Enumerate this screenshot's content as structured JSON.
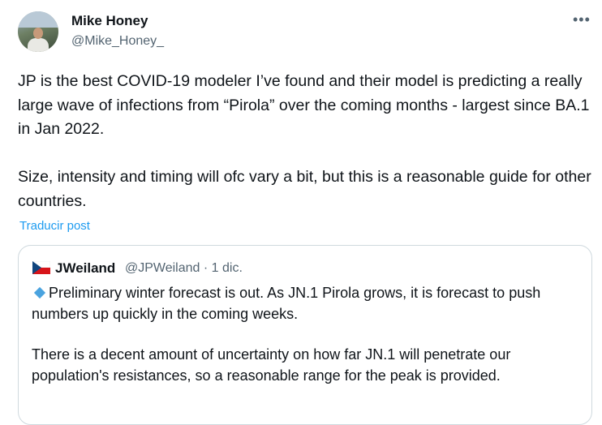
{
  "author": {
    "name": "Mike Honey",
    "handle": "@Mike_Honey_"
  },
  "menu": {
    "more_label": "•••"
  },
  "tweet": {
    "text": "JP is the best COVID-19 modeler I’ve found and their model is predicting a really large wave of infections from “Pirola” over the coming months - largest since BA.1 in Jan 2022.\n\nSize, intensity and timing will ofc vary a bit, but this is a reasonable guide for other countries.",
    "translate_label": "Traducir post"
  },
  "quote": {
    "name": "JWeiland",
    "meta": "@JPWeiland · 1 dic.",
    "paragraph1": "Preliminary winter forecast is out.  As JN.1 Pirola grows, it is forecast to push numbers up quickly in the coming weeks.",
    "paragraph2": "There is a decent amount of uncertainty on how far JN.1 will penetrate our population's resistances, so a reasonable range for the peak is provided."
  },
  "colors": {
    "link": "#1d9bf0",
    "secondary_text": "#536471",
    "border": "#cfd9de",
    "diamond": "#4aa3df"
  }
}
